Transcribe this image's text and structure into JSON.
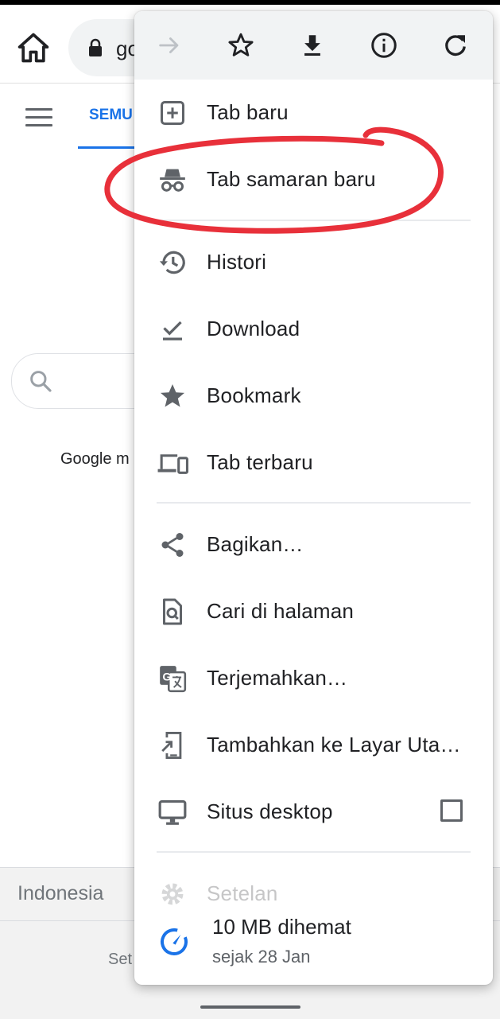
{
  "page": {
    "omnibox_text": "go",
    "tab_all": "SEMU",
    "google_offered": "Google m",
    "footer_country": "Indonesia",
    "footer_settings": "Set"
  },
  "menu": {
    "top_icons": [
      "forward-arrow-icon",
      "star-icon",
      "download-icon",
      "info-icon",
      "refresh-icon"
    ],
    "items": [
      {
        "label": "Tab baru",
        "icon": "new-tab-icon"
      },
      {
        "label": "Tab samaran baru",
        "icon": "incognito-icon"
      },
      {
        "label": "Histori",
        "icon": "history-icon"
      },
      {
        "label": "Download",
        "icon": "download-done-icon"
      },
      {
        "label": "Bookmark",
        "icon": "bookmark-star-icon"
      },
      {
        "label": "Tab terbaru",
        "icon": "devices-icon"
      },
      {
        "label": "Bagikan…",
        "icon": "share-icon"
      },
      {
        "label": "Cari di halaman",
        "icon": "find-in-page-icon"
      },
      {
        "label": "Terjemahkan…",
        "icon": "translate-icon"
      },
      {
        "label": "Tambahkan ke Layar Uta…",
        "icon": "add-to-home-icon"
      },
      {
        "label": "Situs desktop",
        "icon": "desktop-icon",
        "checked": false
      },
      {
        "label": "Setelan",
        "icon": "settings-icon"
      }
    ],
    "savings": {
      "title": "10 MB dihemat",
      "subtitle": "sejak 28 Jan"
    }
  },
  "colors": {
    "accent": "#1a73e8",
    "annotation": "#e8303a",
    "icon": "#5f6368"
  }
}
